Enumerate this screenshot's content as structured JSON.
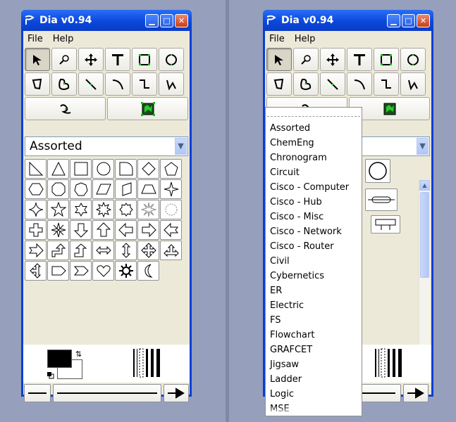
{
  "app": {
    "title": "Dia v0.94",
    "menus": [
      "File",
      "Help"
    ],
    "window_buttons": [
      "minimize",
      "maximize",
      "close"
    ]
  },
  "toolbox": {
    "row1": [
      "select-arrow-icon",
      "magnify-icon",
      "move-icon",
      "text-icon",
      "box-icon",
      "ellipse-icon"
    ],
    "row2": [
      "polygon-icon",
      "beziergon-icon",
      "line-icon",
      "arc-icon",
      "zigzag-line-icon",
      "polyline-icon"
    ],
    "row3": [
      "bezier-line-icon",
      "image-icon"
    ]
  },
  "sheet_selector": {
    "selected": "Assorted"
  },
  "sheet_options": [
    "Assorted",
    "ChemEng",
    "Chronogram",
    "Circuit",
    "Cisco - Computer",
    "Cisco - Hub",
    "Cisco - Misc",
    "Cisco - Network",
    "Cisco - Router",
    "Civil",
    "Cybernetics",
    "ER",
    "Electric",
    "FS",
    "Flowchart",
    "GRAFCET",
    "Jigsaw",
    "Ladder",
    "Logic",
    "MSE"
  ],
  "shapes": [
    [
      "right-triangle-icon",
      "triangle-icon",
      "square-icon",
      "circle-icon",
      "quarter-circle-icon",
      "diamond-icon",
      "pentagon-icon"
    ],
    [
      "hexagon-icon",
      "octagon-icon",
      "heptagon-icon",
      "parallelogram-icon",
      "slanted-rect-icon",
      "trapezoid-icon",
      "star4-icon"
    ],
    [
      "star4-outline-icon",
      "star5-icon",
      "star6-icon",
      "star8-icon",
      "star-round-icon",
      "burst-icon",
      "seal-icon"
    ],
    [
      "cross-icon",
      "compass-star-icon",
      "arrow-down-icon",
      "arrow-up-icon",
      "arrow-left-icon",
      "arrow-right-icon",
      "notched-arrow-left-icon"
    ],
    [
      "notched-arrow-right-icon",
      "bent-arrow-up-icon",
      "bent-arrow-up2-icon",
      "double-arrow-horizontal-icon",
      "double-arrow-vertical-icon",
      "quad-arrow-icon",
      "arrow-up-left-right-icon"
    ],
    [
      "left-right-up-arrow-icon",
      "pentagon-arrow-icon",
      "chevron-icon",
      "heart-icon",
      "gear-icon",
      "moon-icon"
    ]
  ],
  "colors": {
    "foreground": "#000000",
    "background": "#ffffff",
    "titlebar": "#0a3fd6",
    "client": "#ece9d8"
  }
}
